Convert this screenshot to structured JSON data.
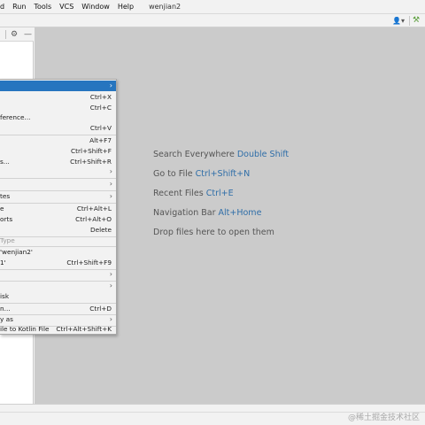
{
  "menubar": {
    "items": [
      "d",
      "Run",
      "Tools",
      "VCS",
      "Window",
      "Help"
    ],
    "project_name": "wenjian2"
  },
  "toolbar": {
    "user_icon": "user-dropdown-icon",
    "build_icon": "hammer-icon"
  },
  "project_panel": {
    "icons": [
      "gear-icon",
      "minimize-icon"
    ]
  },
  "context_menu": {
    "items": [
      {
        "label": "",
        "shortcut": "",
        "submenu": true
      },
      {
        "label": "",
        "shortcut": "Ctrl+X"
      },
      {
        "label": "",
        "shortcut": "Ctrl+C"
      },
      {
        "label": "ference...",
        "shortcut": ""
      },
      {
        "label": "",
        "shortcut": "Ctrl+V"
      },
      {
        "label": "",
        "shortcut": "Alt+F7"
      },
      {
        "label": "",
        "shortcut": "Ctrl+Shift+F"
      },
      {
        "label": "s...",
        "shortcut": "Ctrl+Shift+R"
      },
      {
        "label": "",
        "shortcut": "",
        "submenu": true
      },
      {
        "label": "",
        "shortcut": "",
        "submenu": true
      },
      {
        "label": "tes",
        "shortcut": "",
        "submenu": true
      },
      {
        "label": "e",
        "shortcut": "Ctrl+Alt+L"
      },
      {
        "label": "orts",
        "shortcut": "Ctrl+Alt+O"
      },
      {
        "label": "",
        "shortcut": "Delete"
      },
      {
        "label": "Type",
        "shortcut": "",
        "disabled": true
      },
      {
        "label": "'wenjian2'",
        "shortcut": ""
      },
      {
        "label": "1'",
        "shortcut": "Ctrl+Shift+F9"
      },
      {
        "label": "",
        "shortcut": "",
        "submenu": true
      },
      {
        "label": "",
        "shortcut": "",
        "submenu": true
      },
      {
        "label": "isk",
        "shortcut": ""
      },
      {
        "label": "n...",
        "shortcut": "Ctrl+D"
      },
      {
        "label": "y as",
        "shortcut": "",
        "submenu": true
      },
      {
        "label": "ile to Kotlin File",
        "shortcut": "Ctrl+Alt+Shift+K"
      }
    ]
  },
  "editor_hints": [
    {
      "text": "Search Everywhere ",
      "key": "Double Shift"
    },
    {
      "text": "Go to File ",
      "key": "Ctrl+Shift+N"
    },
    {
      "text": "Recent Files ",
      "key": "Ctrl+E"
    },
    {
      "text": "Navigation Bar ",
      "key": "Alt+Home"
    },
    {
      "text": "Drop files here to open them",
      "key": ""
    }
  ],
  "status_bar": {
    "watermark": "@稀土掘金技术社区"
  },
  "colors": {
    "selection": "#2675bf",
    "editor_bg": "#cbcbcb",
    "hint_key": "#2f6ea8"
  }
}
